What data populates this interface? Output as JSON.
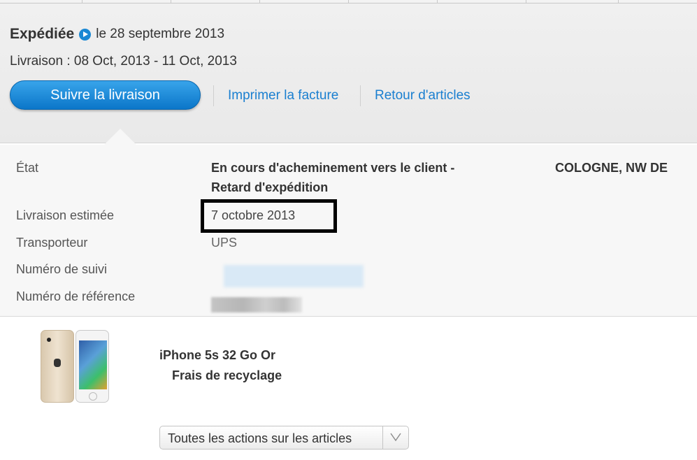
{
  "order": {
    "status_title": "Expédiée",
    "status_date": "le 28 septembre 2013",
    "delivery_window": "Livraison : 08 Oct, 2013 - 11 Oct, 2013",
    "track_button": "Suivre la livraison",
    "print_invoice_link": "Imprimer la facture",
    "return_items_link": "Retour d'articles"
  },
  "tracking": {
    "state_label": "État",
    "state_value_line1": "En cours d'acheminement vers le client -",
    "state_value_line2": "Retard d'expédition",
    "location": "COLOGNE, NW DE",
    "estimated_delivery_label": "Livraison estimée",
    "estimated_delivery_value": "7 octobre 2013",
    "carrier_label": "Transporteur",
    "carrier_value": "UPS",
    "tracking_number_label": "Numéro de suivi",
    "reference_number_label": "Numéro de référence"
  },
  "product": {
    "name": "iPhone 5s 32 Go Or",
    "sub_item": "Frais de recyclage",
    "actions_select": "Toutes les actions sur les articles"
  },
  "colors": {
    "accent_blue": "#1a88d4",
    "link_blue": "#1a7fd0",
    "header_bg": "#ececec",
    "details_bg": "#f7f7f7"
  },
  "icons": {
    "status": "play-circle-icon",
    "dropdown": "chevron-down-icon"
  }
}
